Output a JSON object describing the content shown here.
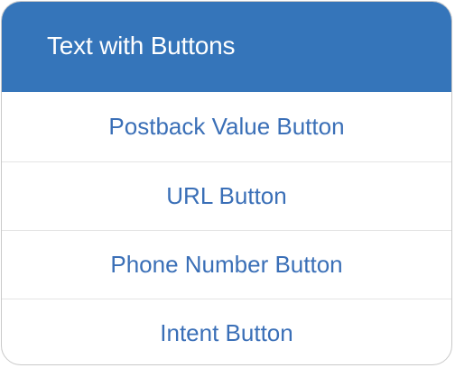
{
  "card": {
    "title": "Text with Buttons",
    "buttons": [
      {
        "label": "Postback Value Button"
      },
      {
        "label": "URL Button"
      },
      {
        "label": "Phone Number Button"
      },
      {
        "label": "Intent Button"
      }
    ]
  },
  "colors": {
    "header_bg": "#3575ba",
    "header_text": "#ffffff",
    "button_text": "#3a6fb7",
    "divider": "#e4e4e4",
    "card_border": "#c9c9c9"
  }
}
